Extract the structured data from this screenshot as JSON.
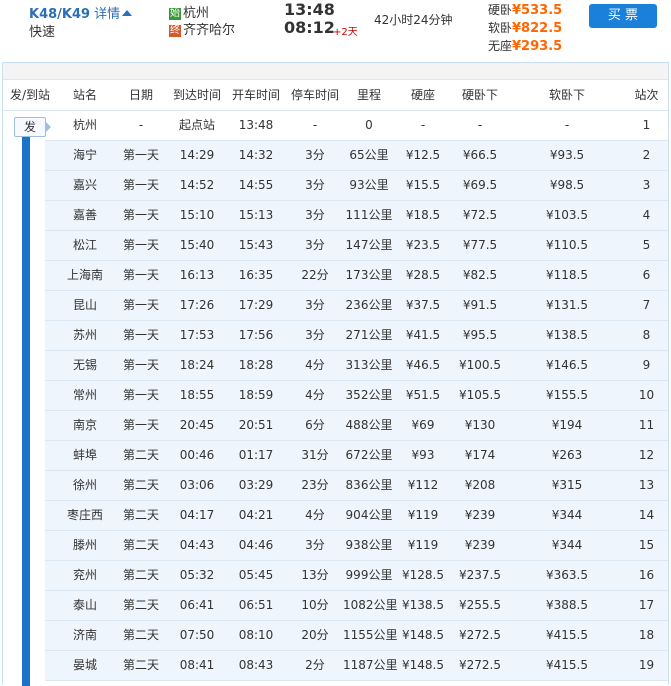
{
  "train": {
    "number": "K48/K49",
    "detail_label": "详情",
    "type": "快速",
    "from": {
      "tag": "始",
      "name": "杭州",
      "time": "13:48"
    },
    "to": {
      "tag": "终",
      "name": "齐齐哈尔",
      "time": "08:12",
      "day_offset": "+2天"
    },
    "duration": "42小时24分钟",
    "fares": [
      {
        "label": "硬卧",
        "price": "¥533.5"
      },
      {
        "label": "软卧",
        "price": "¥822.5"
      },
      {
        "label": "无座",
        "price": "¥293.5"
      }
    ],
    "buy_label": "买 票"
  },
  "table": {
    "departure_marker": "发",
    "headers": [
      "发/到站",
      "站名",
      "日期",
      "到达时间",
      "开车时间",
      "停车时间",
      "里程",
      "硬座",
      "硬卧下",
      "软卧下",
      "站次"
    ],
    "rows": [
      [
        "杭州",
        "-",
        "起点站",
        "13:48",
        "-",
        "0",
        "-",
        "-",
        "-",
        "1"
      ],
      [
        "海宁",
        "第一天",
        "14:29",
        "14:32",
        "3分",
        "65公里",
        "¥12.5",
        "¥66.5",
        "¥93.5",
        "2"
      ],
      [
        "嘉兴",
        "第一天",
        "14:52",
        "14:55",
        "3分",
        "93公里",
        "¥15.5",
        "¥69.5",
        "¥98.5",
        "3"
      ],
      [
        "嘉善",
        "第一天",
        "15:10",
        "15:13",
        "3分",
        "111公里",
        "¥18.5",
        "¥72.5",
        "¥103.5",
        "4"
      ],
      [
        "松江",
        "第一天",
        "15:40",
        "15:43",
        "3分",
        "147公里",
        "¥23.5",
        "¥77.5",
        "¥110.5",
        "5"
      ],
      [
        "上海南",
        "第一天",
        "16:13",
        "16:35",
        "22分",
        "173公里",
        "¥28.5",
        "¥82.5",
        "¥118.5",
        "6"
      ],
      [
        "昆山",
        "第一天",
        "17:26",
        "17:29",
        "3分",
        "236公里",
        "¥37.5",
        "¥91.5",
        "¥131.5",
        "7"
      ],
      [
        "苏州",
        "第一天",
        "17:53",
        "17:56",
        "3分",
        "271公里",
        "¥41.5",
        "¥95.5",
        "¥138.5",
        "8"
      ],
      [
        "无锡",
        "第一天",
        "18:24",
        "18:28",
        "4分",
        "313公里",
        "¥46.5",
        "¥100.5",
        "¥146.5",
        "9"
      ],
      [
        "常州",
        "第一天",
        "18:55",
        "18:59",
        "4分",
        "352公里",
        "¥51.5",
        "¥105.5",
        "¥155.5",
        "10"
      ],
      [
        "南京",
        "第一天",
        "20:45",
        "20:51",
        "6分",
        "488公里",
        "¥69",
        "¥130",
        "¥194",
        "11"
      ],
      [
        "蚌埠",
        "第二天",
        "00:46",
        "01:17",
        "31分",
        "672公里",
        "¥93",
        "¥174",
        "¥263",
        "12"
      ],
      [
        "徐州",
        "第二天",
        "03:06",
        "03:29",
        "23分",
        "836公里",
        "¥112",
        "¥208",
        "¥315",
        "13"
      ],
      [
        "枣庄西",
        "第二天",
        "04:17",
        "04:21",
        "4分",
        "904公里",
        "¥119",
        "¥239",
        "¥344",
        "14"
      ],
      [
        "滕州",
        "第二天",
        "04:43",
        "04:46",
        "3分",
        "938公里",
        "¥119",
        "¥239",
        "¥344",
        "15"
      ],
      [
        "兖州",
        "第二天",
        "05:32",
        "05:45",
        "13分",
        "999公里",
        "¥128.5",
        "¥237.5",
        "¥363.5",
        "16"
      ],
      [
        "泰山",
        "第二天",
        "06:41",
        "06:51",
        "10分",
        "1082公里",
        "¥138.5",
        "¥255.5",
        "¥388.5",
        "17"
      ],
      [
        "济南",
        "第二天",
        "07:50",
        "08:10",
        "20分",
        "1155公里",
        "¥148.5",
        "¥272.5",
        "¥415.5",
        "18"
      ],
      [
        "晏城",
        "第二天",
        "08:41",
        "08:43",
        "2分",
        "1187公里",
        "¥148.5",
        "¥272.5",
        "¥415.5",
        "19"
      ]
    ]
  },
  "colors": {
    "accent": "#1a80d9",
    "price": "#ff6600",
    "row_highlight": "#eef5fc",
    "route_bar": "#1a73c9"
  }
}
